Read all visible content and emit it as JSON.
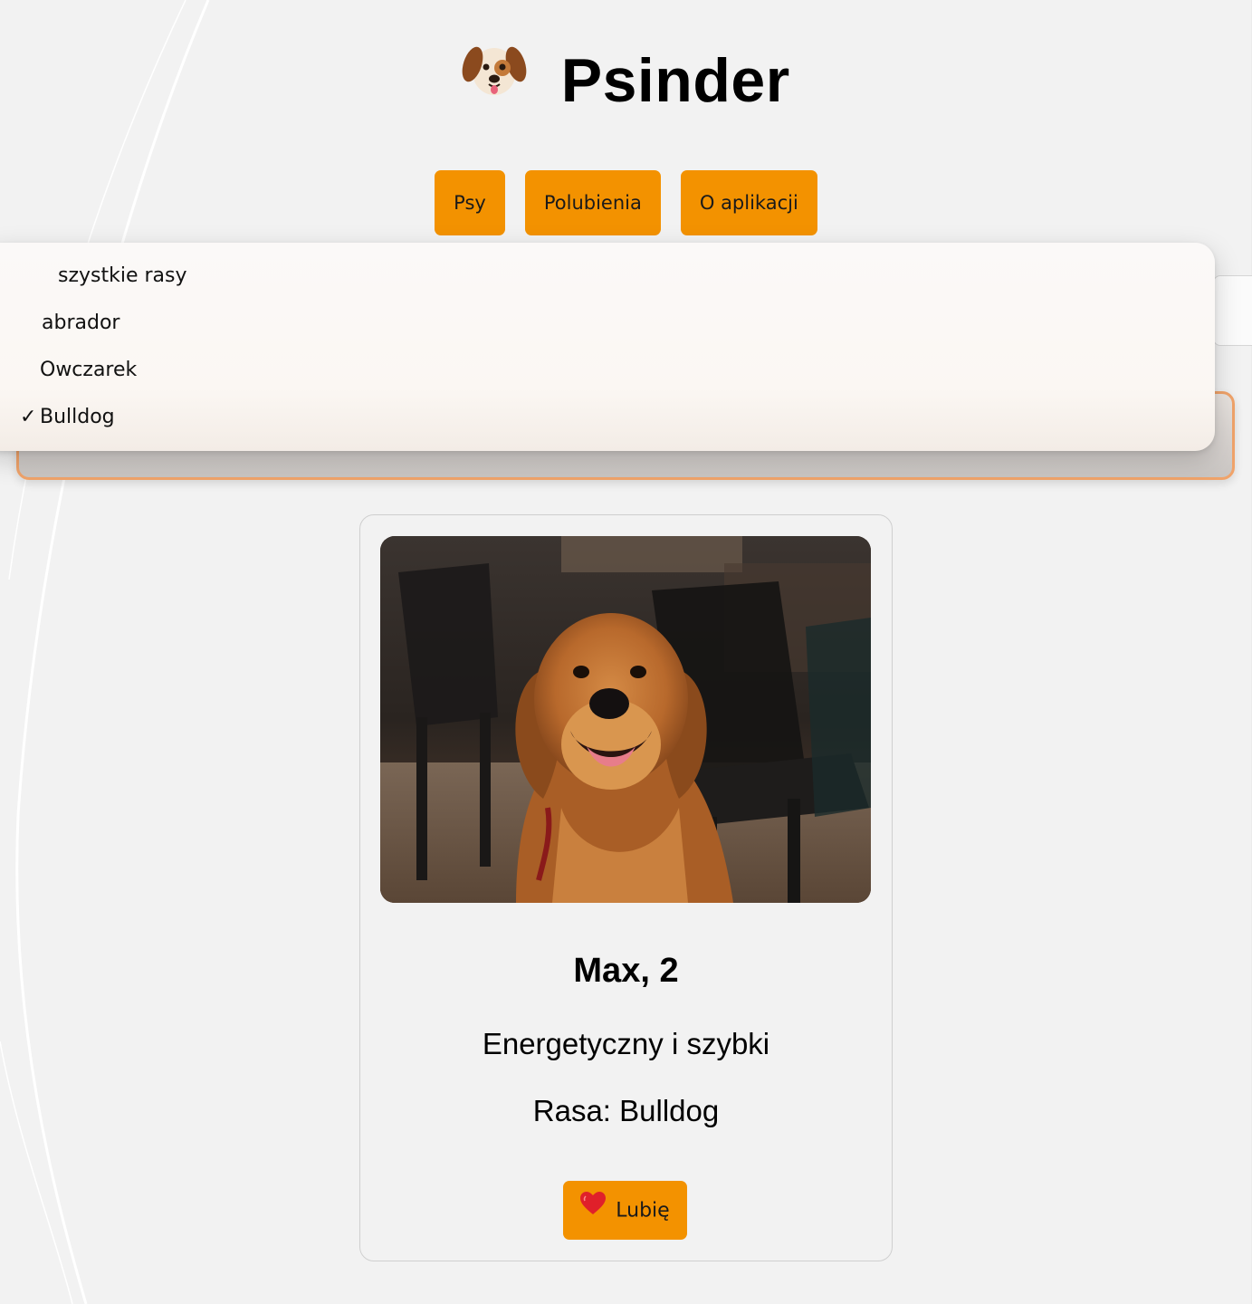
{
  "app": {
    "title": "Psinder",
    "logo_icon": "dog-face-icon"
  },
  "nav": {
    "items": [
      {
        "label": "Psy"
      },
      {
        "label": "Polubienia"
      },
      {
        "label": "O aplikacji"
      }
    ]
  },
  "breed_filter": {
    "options": [
      {
        "label": "szystkie rasy",
        "selected": false
      },
      {
        "label": "abrador",
        "selected": false
      },
      {
        "label": "Owczarek",
        "selected": false
      },
      {
        "label": "Bulldog",
        "selected": true
      }
    ],
    "check_mark": "✓"
  },
  "dog_card": {
    "name_age": "Max, 2",
    "description": "Energetyczny i szybki",
    "breed": "Rasa: Bulldog",
    "like_button": "Lubię",
    "like_icon": "heart-icon"
  },
  "colors": {
    "accent": "#f39200",
    "select_border": "#f0a36a",
    "background": "#f2f2f2"
  }
}
